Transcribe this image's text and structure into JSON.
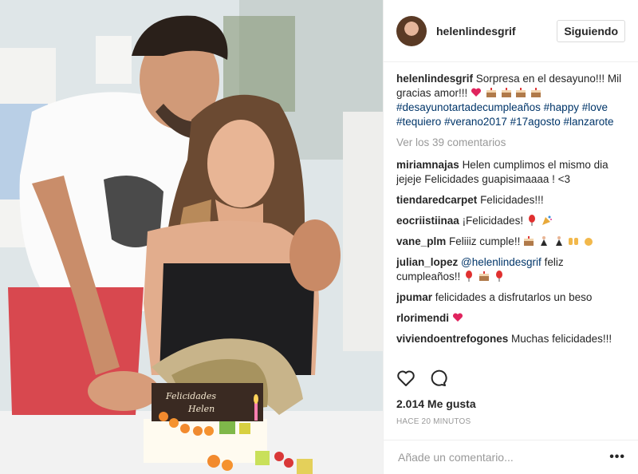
{
  "photo": {
    "cake_text": "Felicidades Helen"
  },
  "header": {
    "username": "helenlindesgrif",
    "follow_label": "Siguiendo"
  },
  "caption": {
    "username": "helenlindesgrif",
    "text": "Sorpresa en el desayuno!!! Mil gracias amor!!!",
    "hashtags": [
      "#desayunotartadecumpleaños",
      "#happy",
      "#love",
      "#tequiero",
      "#verano2017",
      "#17agosto",
      "#lanzarote"
    ]
  },
  "view_comments": "Ver los 39 comentarios",
  "comments": [
    {
      "user": "miriamnajas",
      "text": "Helen cumplimos el mismo dia jejeje Felicidades guapisimaaaa ! <3"
    },
    {
      "user": "tiendaredcarpet",
      "text": "Felicidades!!!"
    },
    {
      "user": "eocriistiinaa",
      "text": "¡Felicidades!"
    },
    {
      "user": "vane_plm",
      "text": "Feliiiz cumple!!"
    },
    {
      "user": "julian_lopez",
      "mention": "@helenlindesgrif",
      "text": "feliz cumpleaños!!"
    },
    {
      "user": "jpumar",
      "text": "felicidades a disfrutarlos un beso"
    },
    {
      "user": "rlorimendi",
      "text": ""
    },
    {
      "user": "viviendoentrefogones",
      "text": "Muchas felicidades!!!"
    }
  ],
  "icons": [
    "heart-icon",
    "comment-icon",
    "more-options-icon"
  ],
  "likes": "2.014 Me gusta",
  "time": "HACE 20 MINUTOS",
  "add_comment": {
    "placeholder": "Añade un comentario...",
    "more": "•••"
  }
}
